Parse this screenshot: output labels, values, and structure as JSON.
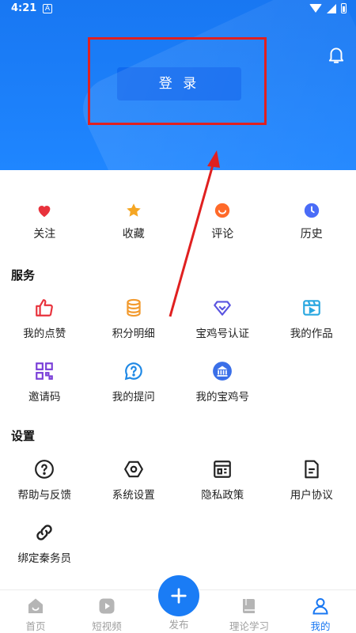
{
  "status_bar": {
    "time": "4:21",
    "app_badge": "A"
  },
  "header": {
    "login_label": "登 录"
  },
  "quick_actions": [
    {
      "label": "关注",
      "icon": "heart-icon",
      "color": "#e8323c"
    },
    {
      "label": "收藏",
      "icon": "star-icon",
      "color": "#f5a623"
    },
    {
      "label": "评论",
      "icon": "comment-icon",
      "color": "#ff6a2a"
    },
    {
      "label": "历史",
      "icon": "clock-icon",
      "color": "#4a6cf7"
    }
  ],
  "services": {
    "title": "服务",
    "items": [
      {
        "label": "我的点赞",
        "icon": "thumbs-up-icon",
        "color": "#e8323c"
      },
      {
        "label": "积分明细",
        "icon": "coins-icon",
        "color": "#f29a2e"
      },
      {
        "label": "宝鸡号认证",
        "icon": "verified-badge-icon",
        "color": "#5a54e0"
      },
      {
        "label": "我的作品",
        "icon": "video-clip-icon",
        "color": "#2aa8e0"
      },
      {
        "label": "邀请码",
        "icon": "qr-code-icon",
        "color": "#7a3fd8"
      },
      {
        "label": "我的提问",
        "icon": "question-bubble-icon",
        "color": "#1e88e5"
      },
      {
        "label": "我的宝鸡号",
        "icon": "baoji-account-icon",
        "color": "#3a6fe8"
      }
    ]
  },
  "settings": {
    "title": "设置",
    "items": [
      {
        "label": "帮助与反馈",
        "icon": "help-icon"
      },
      {
        "label": "系统设置",
        "icon": "hexagon-settings-icon"
      },
      {
        "label": "隐私政策",
        "icon": "privacy-doc-icon"
      },
      {
        "label": "用户协议",
        "icon": "document-icon"
      },
      {
        "label": "绑定秦务员",
        "icon": "link-icon"
      }
    ]
  },
  "bottom_nav": {
    "items": [
      {
        "label": "首页",
        "icon": "home-icon",
        "active": false
      },
      {
        "label": "短视频",
        "icon": "play-icon",
        "active": false
      },
      {
        "label": "理论学习",
        "icon": "book-icon",
        "active": false
      },
      {
        "label": "我的",
        "icon": "person-icon",
        "active": true
      }
    ],
    "publish_label": "发布"
  },
  "colors": {
    "accent": "#1877f2",
    "header": "#1a7cf5",
    "annotation": "#e02020"
  }
}
